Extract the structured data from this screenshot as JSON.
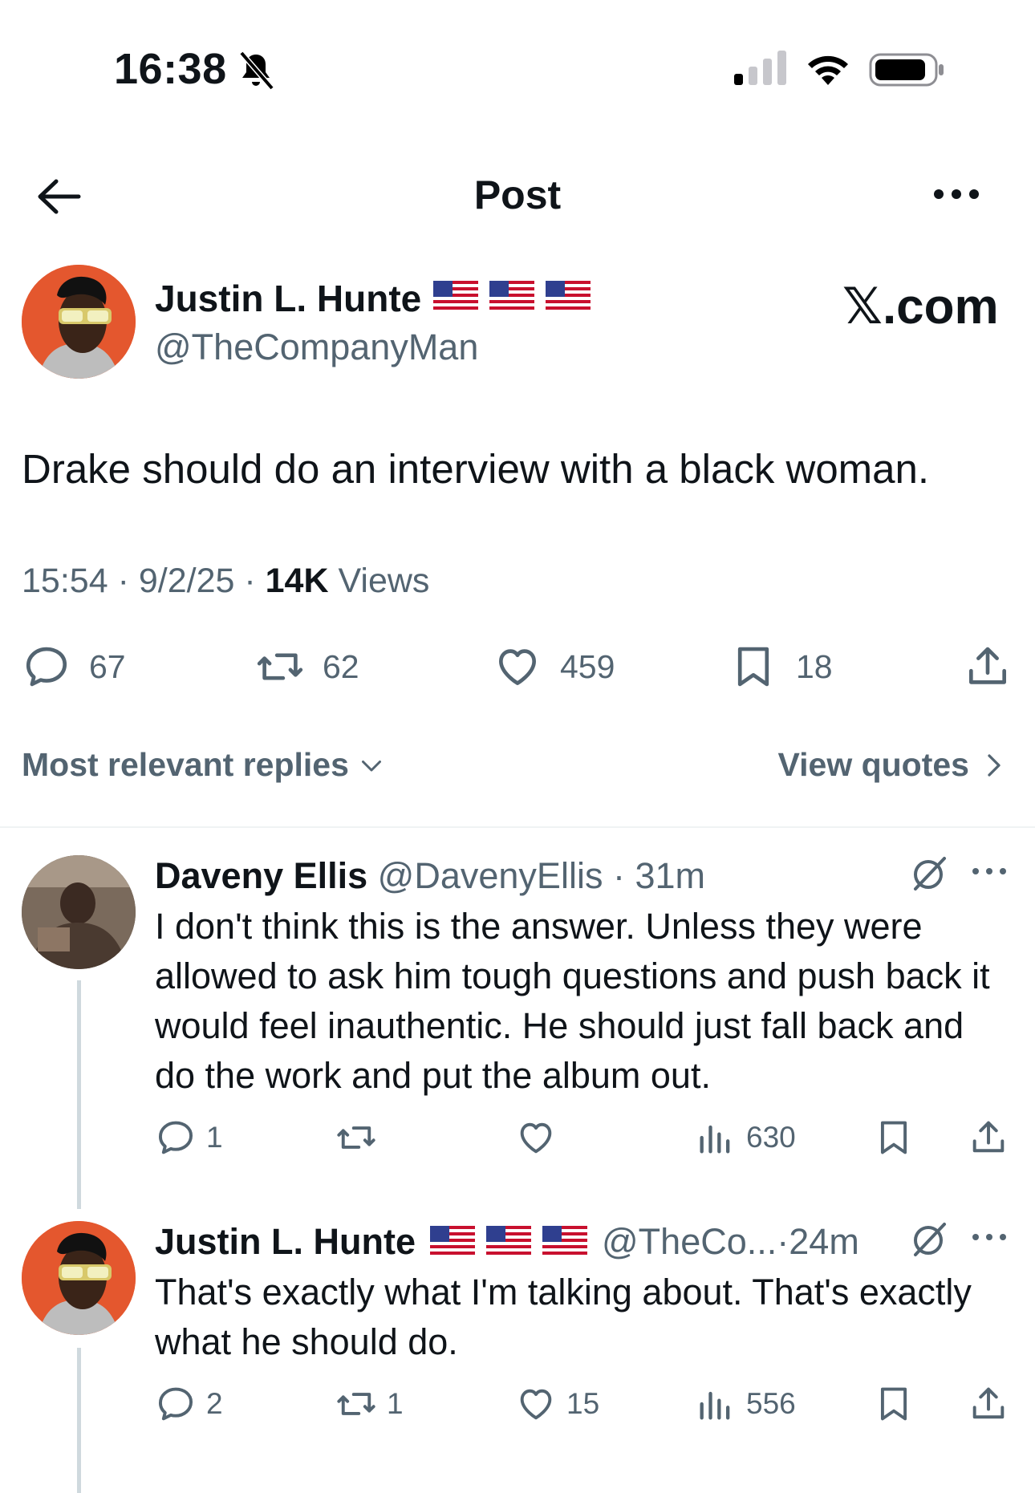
{
  "status_bar": {
    "time": "16:38"
  },
  "header": {
    "title": "Post"
  },
  "post": {
    "author_name": "Justin L. Hunte",
    "author_handle": "@TheCompanyMan",
    "flags": [
      "🇺🇸",
      "🇺🇸",
      "🇺🇸"
    ],
    "source_badge": "𝕏.com",
    "text": "Drake should do an interview with a black woman.",
    "time": "15:54",
    "date": "9/2/25",
    "views_count": "14K",
    "views_label": "Views",
    "stats": {
      "replies": "67",
      "reposts": "62",
      "likes": "459",
      "bookmarks": "18"
    }
  },
  "replies_bar": {
    "sort_label": "Most relevant replies",
    "quotes_label": "View quotes"
  },
  "replies": [
    {
      "name": "Daveny Ellis",
      "handle": "@DavenyEllis",
      "age": "31m",
      "text": "I don't think this is the answer. Unless they were allowed to ask him tough questions and push back it would feel inauthentic. He should just fall back and do the work and put the album out.",
      "replies": "1",
      "reposts": "",
      "likes": "",
      "views": "630"
    },
    {
      "name": "Justin L. Hunte",
      "flags": [
        "🇺🇸",
        "🇺🇸",
        "🇺🇸"
      ],
      "handle": "@TheCo...",
      "age": "24m",
      "text": "That's exactly what I'm talking about. That's exactly what he should do.",
      "replies": "2",
      "reposts": "1",
      "likes": "15",
      "views": "556"
    }
  ],
  "colors": {
    "text": "#0f1419",
    "secondary": "#536471",
    "divider": "#eff3f4",
    "thread": "#cfd9de"
  }
}
